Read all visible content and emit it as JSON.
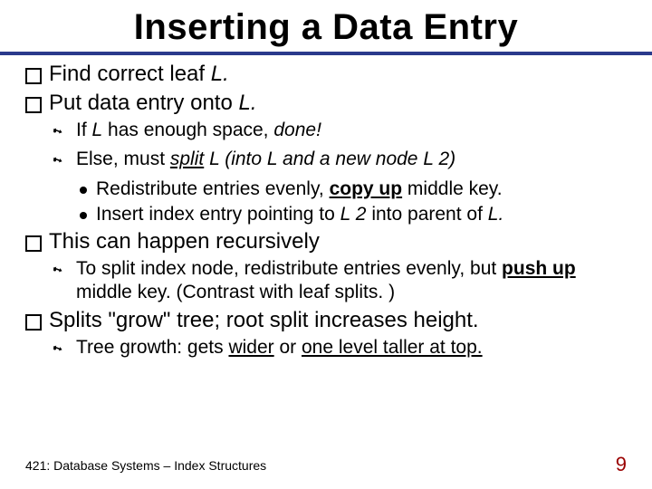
{
  "title": "Inserting a Data Entry",
  "lines": {
    "l1a_pre": "Find correct leaf ",
    "l1a_L": "L.",
    "l1b_pre": "Put data entry onto ",
    "l1b_L": "L.",
    "l2a_pre": "If ",
    "l2a_L": "L",
    "l2a_rest": " has enough space, ",
    "l2a_done": "done!",
    "l2b_pre": "Else, must ",
    "l2b_split": "split",
    "l2b_mid": "  L (into L and a new node L 2)",
    "l3a_pre": "Redistribute entries evenly, ",
    "l3a_copy": "copy up",
    "l3a_post": "  middle key.",
    "l3b_pre": "Insert index entry pointing to ",
    "l3b_L2": "L 2",
    "l3b_post": " into parent of ",
    "l3b_L": "L.",
    "l1c": "This can happen recursively",
    "l2c_pre": "To split index node, redistribute entries evenly, but ",
    "l2c_push": "push up",
    "l2c_post": " middle key.  (Contrast with leaf splits. )",
    "l1d_pre": "Splits \"grow\" tree; root split increases height.",
    "l2d_pre": "Tree growth: gets ",
    "l2d_wider": "wider",
    "l2d_mid": " or ",
    "l2d_taller": "one level taller at top."
  },
  "footer": {
    "left": "421: Database Systems – Index Structures",
    "page": "9"
  }
}
